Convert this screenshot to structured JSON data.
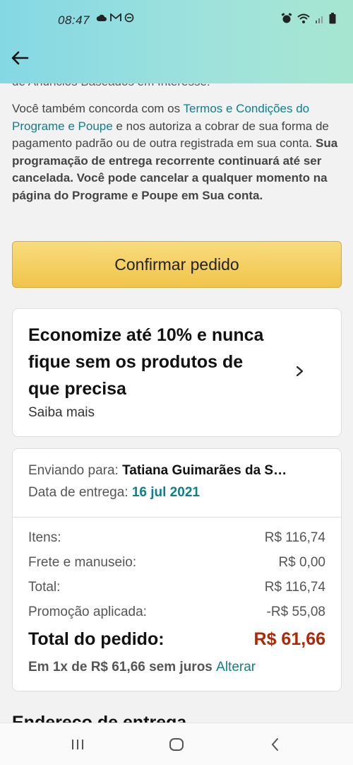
{
  "status_bar": {
    "time": "08:47"
  },
  "header": {
    "back_icon": "arrow-left-icon"
  },
  "content": {
    "cut_off_text": "de Anúncios Baseados em Interesse.",
    "legal": {
      "p1": "Você também concorda com os ",
      "terms_link": "Termos e Condições do Programe e Poupe",
      "p2": " e nos autoriza a cobrar de sua forma de pagamento padrão ou de outra registrada em sua conta. ",
      "bold": "Sua programação de entrega recorrente continuará até ser cancelada. Você pode cancelar a qualquer momento na página do ",
      "program_link": "Programe e Poupe",
      "bold_end": " em Sua conta."
    },
    "confirm_button": "Confirmar pedido",
    "promo": {
      "title": "Economize até 10% e nunca fique sem os produtos de que precisa",
      "link": "Saiba mais"
    },
    "summary": {
      "ship_to_label": "Enviando para: ",
      "ship_to_name": "Tatiana Guimarães da S…",
      "delivery_label": "Data de entrega: ",
      "delivery_date": "16 jul 2021",
      "rows": [
        {
          "label": "Itens:",
          "value": "R$ 116,74"
        },
        {
          "label": "Frete e manuseio:",
          "value": "R$ 0,00"
        },
        {
          "label": "Total:",
          "value": "R$ 116,74"
        },
        {
          "label": "Promoção aplicada:",
          "value": "-R$ 55,08"
        }
      ],
      "order_total_label": "Total do pedido:",
      "order_total_value": "R$ 61,66",
      "installment_text": "Em 1x de R$ 61,66 sem juros ",
      "installment_link": "Alterar"
    },
    "next_section_title": "Endereço de entrega"
  },
  "colors": {
    "link": "#0f7f8c",
    "price_red": "#b12704",
    "button_yellow": "#f1c44a"
  }
}
